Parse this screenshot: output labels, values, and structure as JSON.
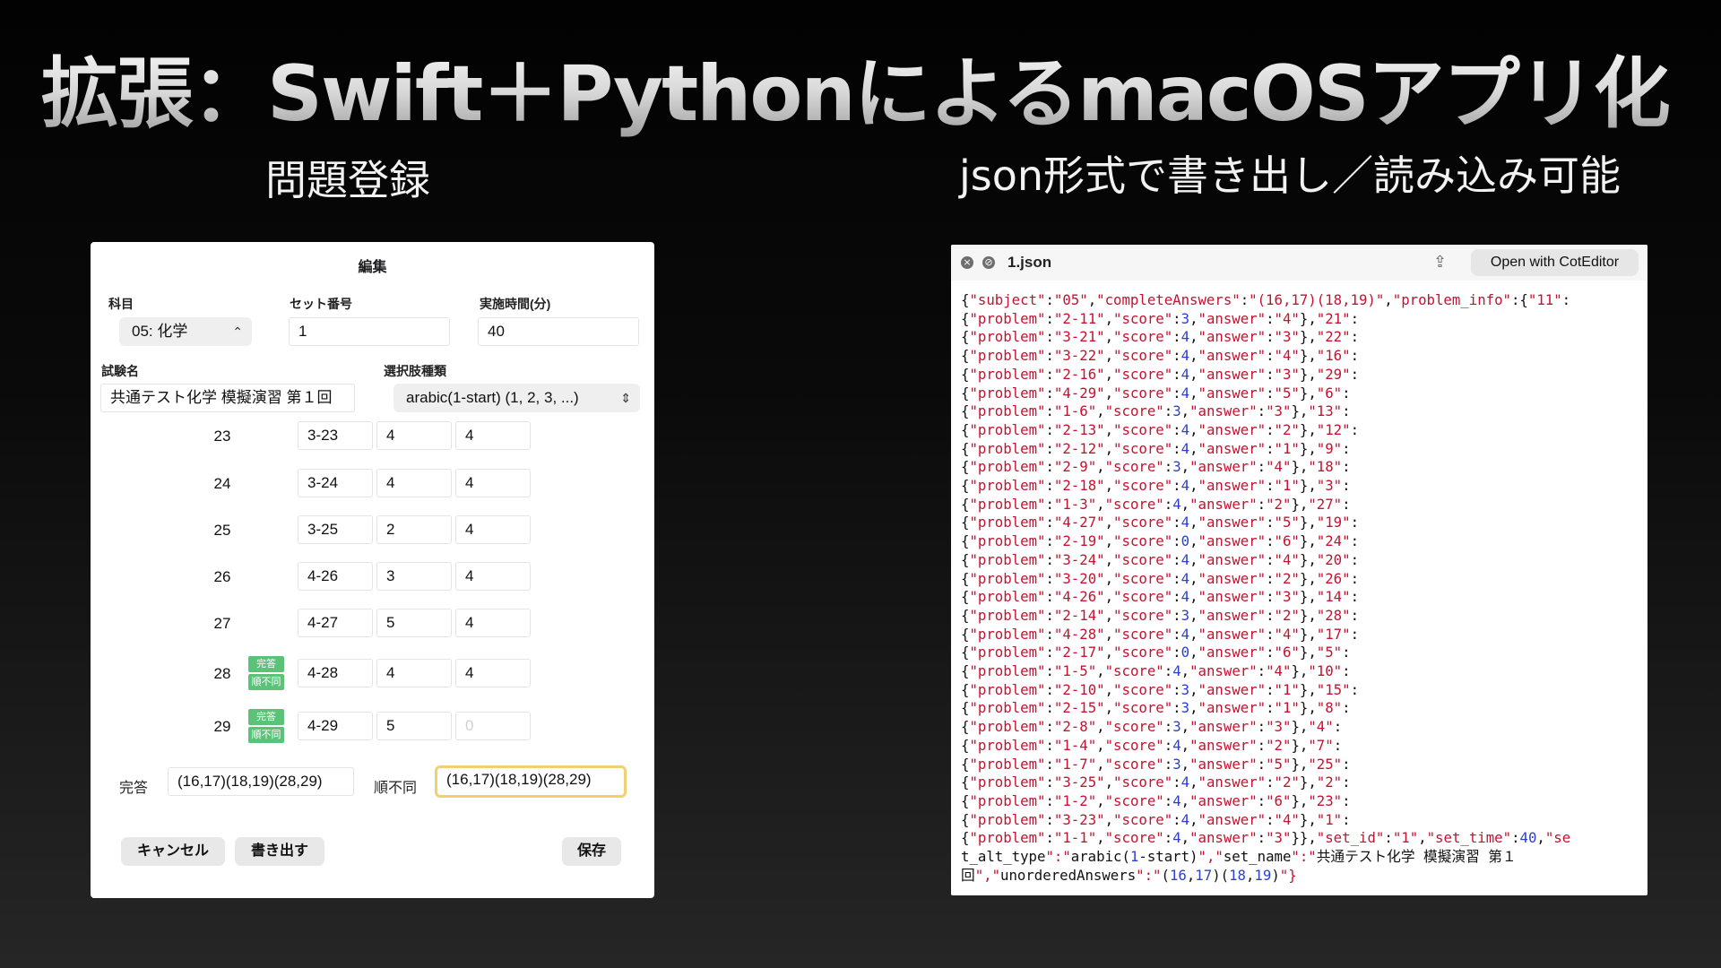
{
  "slide": {
    "title": "拡張：Swift＋PythonによるmacOSアプリ化",
    "left_caption": "問題登録",
    "right_caption": "json形式で書き出し／読み込み可能"
  },
  "edit_window": {
    "title": "編集",
    "subject_label": "科目",
    "subject_value": "05: 化学",
    "set_number_label": "セット番号",
    "set_number_value": "1",
    "time_label": "実施時間(分)",
    "time_value": "40",
    "exam_name_label": "試験名",
    "exam_name_value": "共通テスト化学 模擬演習 第１回",
    "choice_type_label": "選択肢種類",
    "choice_type_value": "arabic(1-start) (1, 2, 3, ...)",
    "rows": [
      {
        "num": "23",
        "problem": "3-23",
        "score": "4",
        "answer": "4",
        "badges": []
      },
      {
        "num": "24",
        "problem": "3-24",
        "score": "4",
        "answer": "4",
        "badges": []
      },
      {
        "num": "25",
        "problem": "3-25",
        "score": "2",
        "answer": "4",
        "badges": []
      },
      {
        "num": "26",
        "problem": "4-26",
        "score": "3",
        "answer": "4",
        "badges": []
      },
      {
        "num": "27",
        "problem": "4-27",
        "score": "5",
        "answer": "4",
        "badges": []
      },
      {
        "num": "28",
        "problem": "4-28",
        "score": "4",
        "answer": "4",
        "badges": [
          "完答",
          "順不同"
        ]
      },
      {
        "num": "29",
        "problem": "4-29",
        "score": "5",
        "answer": "0",
        "badges": [
          "完答",
          "順不同"
        ]
      }
    ],
    "complete_label": "完答",
    "complete_value": "(16,17)(18,19)(28,29)",
    "unordered_label": "順不同",
    "unordered_value": "(16,17)(18,19)(28,29)",
    "cancel_button": "キャンセル",
    "export_button": "書き出す",
    "save_button": "保存"
  },
  "json_window": {
    "filename": "1.json",
    "open_button": "Open with CotEditor",
    "lines": [
      "{\"subject\":\"05\",\"completeAnswers\":\"(16,17)(18,19)\",\"problem_info\":{\"11\":",
      "{\"problem\":\"2-11\",\"score\":3,\"answer\":\"4\"},\"21\":",
      "{\"problem\":\"3-21\",\"score\":4,\"answer\":\"3\"},\"22\":",
      "{\"problem\":\"3-22\",\"score\":4,\"answer\":\"4\"},\"16\":",
      "{\"problem\":\"2-16\",\"score\":4,\"answer\":\"3\"},\"29\":",
      "{\"problem\":\"4-29\",\"score\":4,\"answer\":\"5\"},\"6\":",
      "{\"problem\":\"1-6\",\"score\":3,\"answer\":\"3\"},\"13\":",
      "{\"problem\":\"2-13\",\"score\":4,\"answer\":\"2\"},\"12\":",
      "{\"problem\":\"2-12\",\"score\":4,\"answer\":\"1\"},\"9\":",
      "{\"problem\":\"2-9\",\"score\":3,\"answer\":\"4\"},\"18\":",
      "{\"problem\":\"2-18\",\"score\":4,\"answer\":\"1\"},\"3\":",
      "{\"problem\":\"1-3\",\"score\":4,\"answer\":\"2\"},\"27\":",
      "{\"problem\":\"4-27\",\"score\":4,\"answer\":\"5\"},\"19\":",
      "{\"problem\":\"2-19\",\"score\":0,\"answer\":\"6\"},\"24\":",
      "{\"problem\":\"3-24\",\"score\":4,\"answer\":\"4\"},\"20\":",
      "{\"problem\":\"3-20\",\"score\":4,\"answer\":\"2\"},\"26\":",
      "{\"problem\":\"4-26\",\"score\":4,\"answer\":\"3\"},\"14\":",
      "{\"problem\":\"2-14\",\"score\":3,\"answer\":\"2\"},\"28\":",
      "{\"problem\":\"4-28\",\"score\":4,\"answer\":\"4\"},\"17\":",
      "{\"problem\":\"2-17\",\"score\":0,\"answer\":\"6\"},\"5\":",
      "{\"problem\":\"1-5\",\"score\":4,\"answer\":\"4\"},\"10\":",
      "{\"problem\":\"2-10\",\"score\":3,\"answer\":\"1\"},\"15\":",
      "{\"problem\":\"2-15\",\"score\":3,\"answer\":\"1\"},\"8\":",
      "{\"problem\":\"2-8\",\"score\":3,\"answer\":\"3\"},\"4\":",
      "{\"problem\":\"1-4\",\"score\":4,\"answer\":\"2\"},\"7\":",
      "{\"problem\":\"1-7\",\"score\":3,\"answer\":\"5\"},\"25\":",
      "{\"problem\":\"3-25\",\"score\":4,\"answer\":\"2\"},\"2\":",
      "{\"problem\":\"1-2\",\"score\":4,\"answer\":\"6\"},\"23\":",
      "{\"problem\":\"3-23\",\"score\":4,\"answer\":\"4\"},\"1\":",
      "{\"problem\":\"1-1\",\"score\":4,\"answer\":\"3\"}},\"set_id\":\"1\",\"set_time\":40,\"se",
      "t_alt_type\":\"arabic(1-start)\",\"set_name\":\"共通テスト化学 模擬演習 第１",
      "回\",\"unorderedAnswers\":\"(16,17)(18,19)\"}"
    ]
  },
  "colors": {
    "json_key_and_string": "#c4122f",
    "json_number": "#2a3fd0",
    "badge_green": "#5cc27a",
    "focus_ring": "#f3cf74"
  },
  "icons": [
    "close-icon",
    "disabled-icon",
    "share-icon",
    "chevron-updown-icon"
  ]
}
